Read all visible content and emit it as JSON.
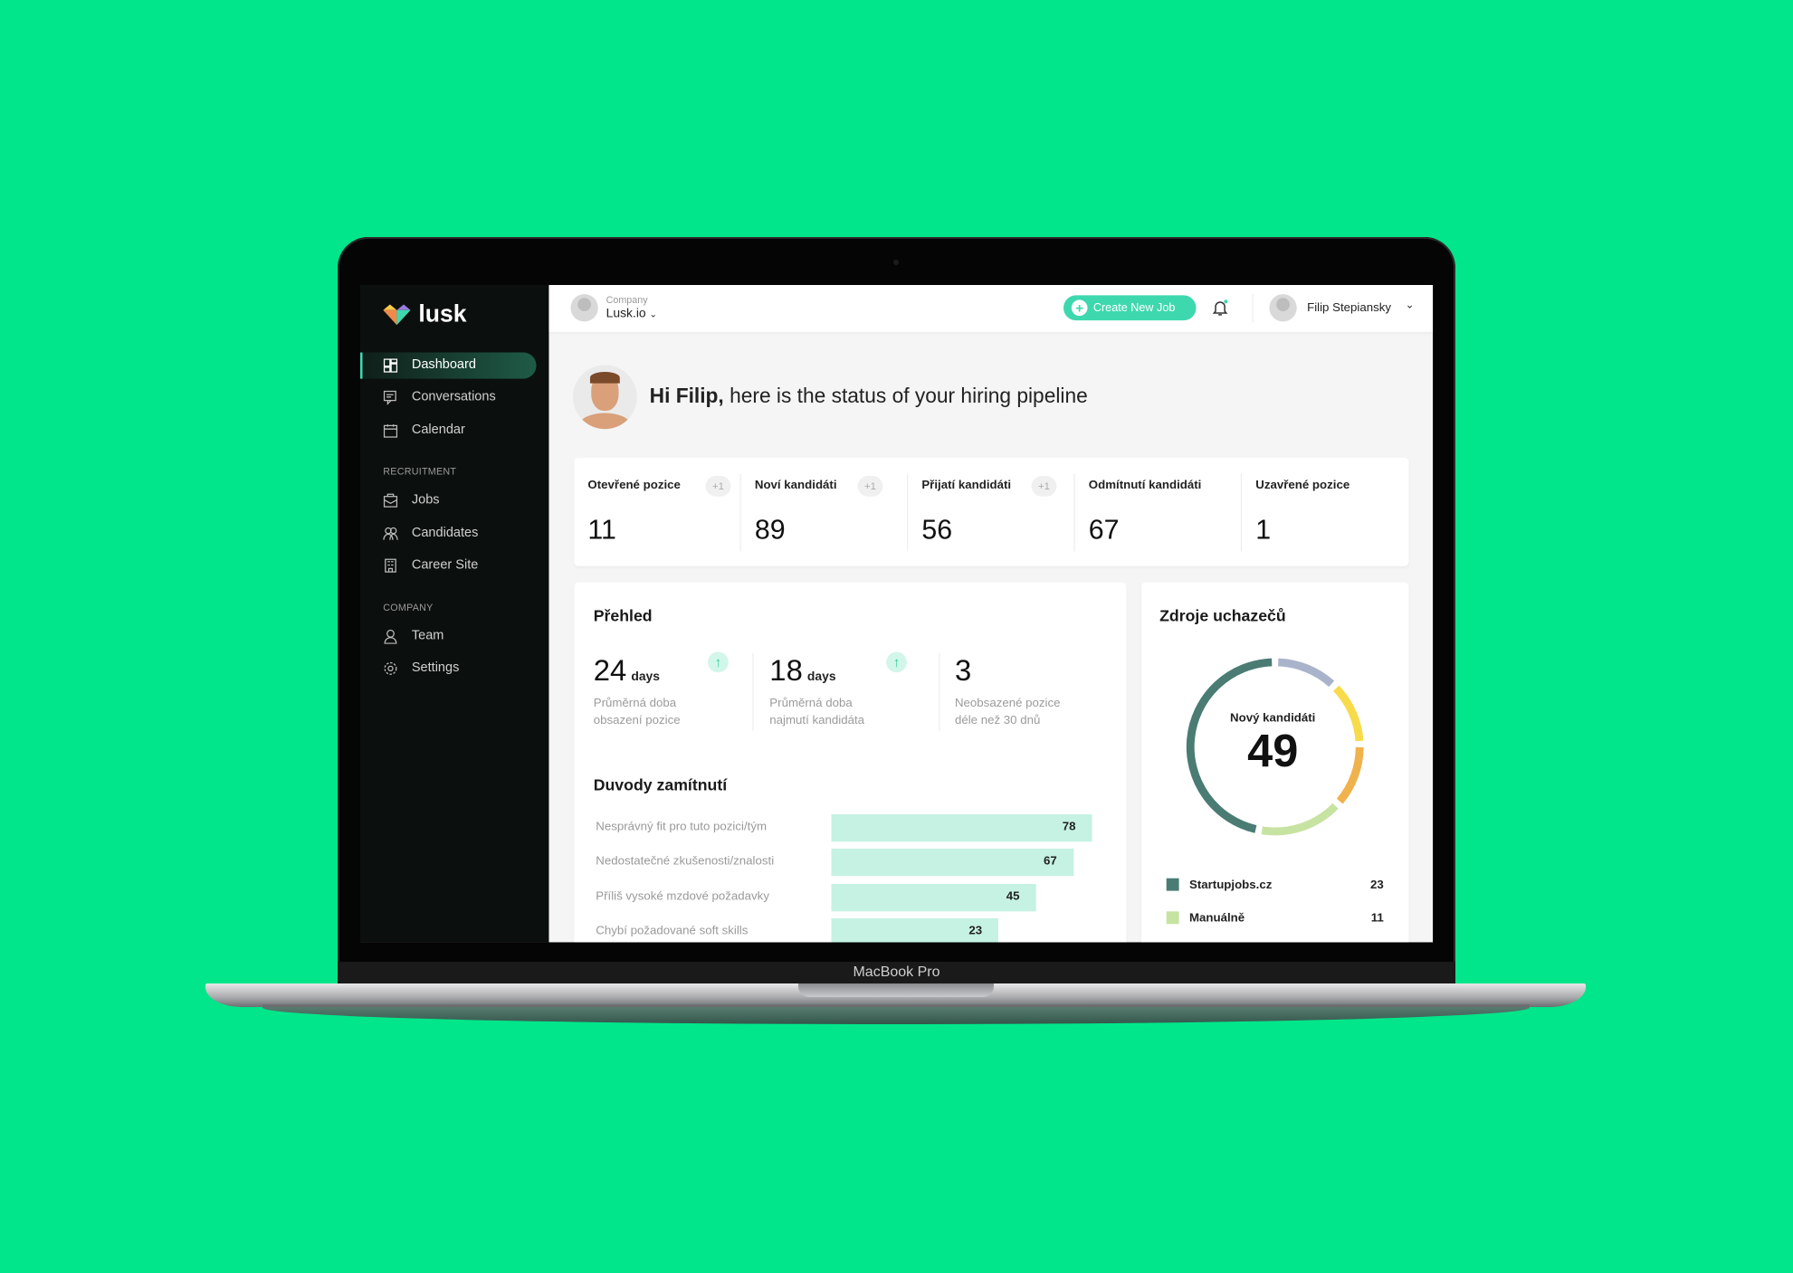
{
  "device_label": "MacBook Pro",
  "sidebar": {
    "logo_text": "lusk",
    "items": [
      {
        "label": "Dashboard",
        "icon": "dashboard-icon",
        "active": true
      },
      {
        "label": "Conversations",
        "icon": "chat-icon"
      },
      {
        "label": "Calendar",
        "icon": "calendar-icon"
      }
    ],
    "recruitment_label": "RECRUITMENT",
    "recruitment_items": [
      {
        "label": "Jobs",
        "icon": "briefcase-icon"
      },
      {
        "label": "Candidates",
        "icon": "users-icon"
      },
      {
        "label": "Career Site",
        "icon": "building-icon"
      }
    ],
    "company_label": "COMPANY",
    "company_items": [
      {
        "label": "Team",
        "icon": "user-icon"
      },
      {
        "label": "Settings",
        "icon": "gear-icon"
      }
    ]
  },
  "topbar": {
    "company_caption": "Company",
    "company_name": "Lusk.io",
    "create_job_label": "Create New Job",
    "user_name": "Filip Stepiansky",
    "notification_dot": true
  },
  "greeting": {
    "bold": "Hi Filip,",
    "rest": " here is the status of your hiring pipeline"
  },
  "stats": [
    {
      "label": "Otevřené pozice",
      "badge": "+1",
      "value": "11"
    },
    {
      "label": "Noví kandidáti",
      "badge": "+1",
      "value": "89"
    },
    {
      "label": "Přijatí kandidáti",
      "badge": "+1",
      "value": "56"
    },
    {
      "label": "Odmítnutí kandidáti",
      "value": "67"
    },
    {
      "label": "Uzavřené pozice",
      "value": "1"
    }
  ],
  "overview": {
    "title": "Přehled",
    "metrics": [
      {
        "value": "24",
        "unit": "days",
        "line1": "Průměrná doba",
        "line2": "obsazení pozice",
        "trend": "up"
      },
      {
        "value": "18",
        "unit": "days",
        "line1": "Průměrná doba",
        "line2": "najmutí kandidáta",
        "trend": "up"
      },
      {
        "value": "3",
        "unit": "",
        "line1": "Neobsazené pozice",
        "line2": "déle než 30 dnů"
      }
    ]
  },
  "rejections": {
    "title": "Duvody zamítnutí",
    "rows": [
      {
        "label": "Nesprávný fit pro tuto pozici/tým",
        "value": 78
      },
      {
        "label": "Nedostatečné zkušenosti/znalosti",
        "value": 67
      },
      {
        "label": "Příliš vysoké mzdové požadavky",
        "value": 45
      },
      {
        "label": "Chybí požadované soft skills",
        "value": 23
      }
    ],
    "bar_color": "#c5f2e3"
  },
  "sources": {
    "title": "Zdroje uchazečů",
    "center_label": "Nový kandidáti",
    "center_value": "49",
    "segments": [
      {
        "value": 23,
        "color": "#4a7c74"
      },
      {
        "value": 8,
        "color": "#c7e3a2"
      },
      {
        "value": 6,
        "color": "#f0b24c"
      },
      {
        "value": 6,
        "color": "#f7db4a"
      },
      {
        "value": 6,
        "color": "#a9b3cb"
      }
    ],
    "legend": [
      {
        "label": "Startupjobs.cz",
        "value": "23",
        "color": "#4a7c74"
      },
      {
        "label": "Manuálně",
        "value": "11",
        "color": "#c7e3a2"
      }
    ]
  }
}
